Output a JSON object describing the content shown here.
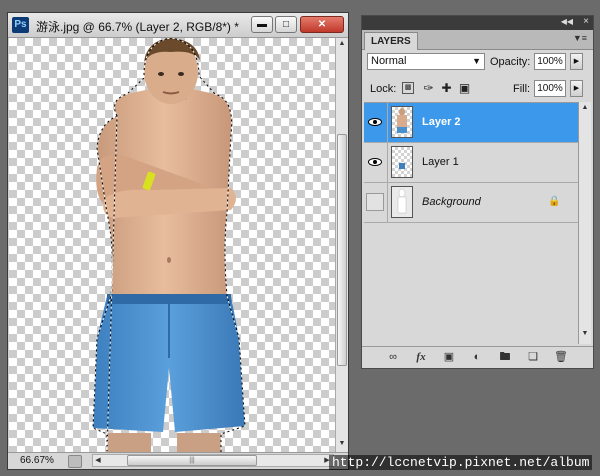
{
  "document": {
    "app_icon": "Ps",
    "title": "游泳.jpg @ 66.7% (Layer 2, RGB/8*) *",
    "window_buttons": {
      "minimize": "minimize-icon",
      "maximize": "maximize-icon",
      "close": "close-icon"
    },
    "status": {
      "zoom": "66.67%"
    },
    "hscroll_thumb_grip": "|||"
  },
  "layers_panel": {
    "tab": "LAYERS",
    "blend_mode": "Normal",
    "opacity_label": "Opacity:",
    "opacity": "100%",
    "lock_label": "Lock:",
    "fill_label": "Fill:",
    "fill": "100%",
    "layers": [
      {
        "name": "Layer 2",
        "visible": true,
        "selected": true
      },
      {
        "name": "Layer 1",
        "visible": true,
        "selected": false
      },
      {
        "name": "Background",
        "visible": false,
        "selected": false,
        "locked": true
      }
    ],
    "footer_icons": [
      "link-layers-icon",
      "fx-icon",
      "layer-mask-icon",
      "adjustment-layer-icon",
      "group-folder-icon",
      "new-layer-icon",
      "delete-layer-icon"
    ]
  },
  "watermark": "http://lccnetvip.pixnet.net/album",
  "colors": {
    "selection": "#3c98ea",
    "shorts": "#4a90cf",
    "skin": "#dcae8e"
  }
}
